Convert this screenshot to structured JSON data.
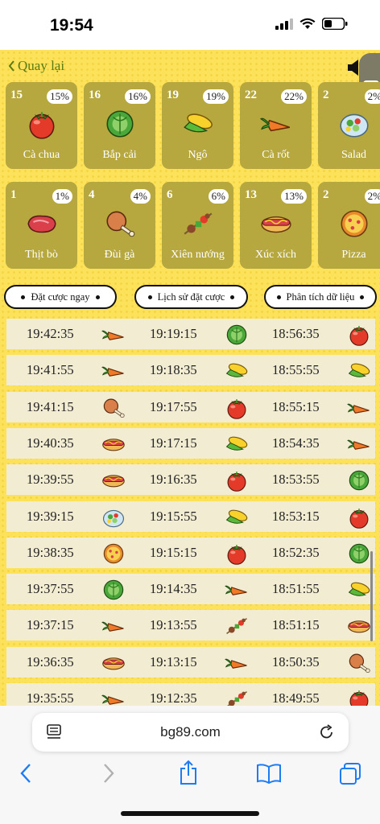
{
  "status": {
    "time": "19:54"
  },
  "nav": {
    "back_label": "Quay lại"
  },
  "cards": [
    {
      "num": "15",
      "pct": "15%",
      "label": "Cà chua",
      "icon": "tomato"
    },
    {
      "num": "16",
      "pct": "16%",
      "label": "Bắp cải",
      "icon": "cabbage"
    },
    {
      "num": "19",
      "pct": "19%",
      "label": "Ngô",
      "icon": "corn"
    },
    {
      "num": "22",
      "pct": "22%",
      "label": "Cà rốt",
      "icon": "carrot"
    },
    {
      "num": "2",
      "pct": "2%",
      "label": "Salad",
      "icon": "salad"
    },
    {
      "num": "1",
      "pct": "1%",
      "label": "Thịt bò",
      "icon": "beef"
    },
    {
      "num": "4",
      "pct": "4%",
      "label": "Đùi gà",
      "icon": "drumstick"
    },
    {
      "num": "6",
      "pct": "6%",
      "label": "Xiên nướng",
      "icon": "skewer"
    },
    {
      "num": "13",
      "pct": "13%",
      "label": "Xúc xích",
      "icon": "hotdog"
    },
    {
      "num": "2",
      "pct": "2%",
      "label": "Pizza",
      "icon": "pizza"
    }
  ],
  "tabs": [
    {
      "label": "Đặt cược ngay"
    },
    {
      "label": "Lịch sử đặt cược"
    },
    {
      "label": "Phân tích dữ liệu"
    }
  ],
  "history": [
    [
      {
        "time": "19:42:35",
        "icon": "carrot"
      },
      {
        "time": "19:19:15",
        "icon": "cabbage"
      },
      {
        "time": "18:56:35",
        "icon": "tomato"
      }
    ],
    [
      {
        "time": "19:41:55",
        "icon": "carrot"
      },
      {
        "time": "19:18:35",
        "icon": "corn"
      },
      {
        "time": "18:55:55",
        "icon": "corn"
      }
    ],
    [
      {
        "time": "19:41:15",
        "icon": "drumstick"
      },
      {
        "time": "19:17:55",
        "icon": "tomato"
      },
      {
        "time": "18:55:15",
        "icon": "carrot"
      }
    ],
    [
      {
        "time": "19:40:35",
        "icon": "hotdog"
      },
      {
        "time": "19:17:15",
        "icon": "corn"
      },
      {
        "time": "18:54:35",
        "icon": "carrot"
      }
    ],
    [
      {
        "time": "19:39:55",
        "icon": "hotdog"
      },
      {
        "time": "19:16:35",
        "icon": "tomato"
      },
      {
        "time": "18:53:55",
        "icon": "cabbage"
      }
    ],
    [
      {
        "time": "19:39:15",
        "icon": "salad"
      },
      {
        "time": "19:15:55",
        "icon": "corn"
      },
      {
        "time": "18:53:15",
        "icon": "tomato"
      }
    ],
    [
      {
        "time": "19:38:35",
        "icon": "pizza"
      },
      {
        "time": "19:15:15",
        "icon": "tomato"
      },
      {
        "time": "18:52:35",
        "icon": "cabbage"
      }
    ],
    [
      {
        "time": "19:37:55",
        "icon": "cabbage"
      },
      {
        "time": "19:14:35",
        "icon": "carrot"
      },
      {
        "time": "18:51:55",
        "icon": "corn"
      }
    ],
    [
      {
        "time": "19:37:15",
        "icon": "carrot"
      },
      {
        "time": "19:13:55",
        "icon": "skewer"
      },
      {
        "time": "18:51:15",
        "icon": "hotdog"
      }
    ],
    [
      {
        "time": "19:36:35",
        "icon": "hotdog"
      },
      {
        "time": "19:13:15",
        "icon": "carrot"
      },
      {
        "time": "18:50:35",
        "icon": "drumstick"
      }
    ],
    [
      {
        "time": "19:35:55",
        "icon": "carrot"
      },
      {
        "time": "19:12:35",
        "icon": "skewer"
      },
      {
        "time": "18:49:55",
        "icon": "tomato"
      }
    ]
  ],
  "browser": {
    "url": "bg89.com"
  }
}
